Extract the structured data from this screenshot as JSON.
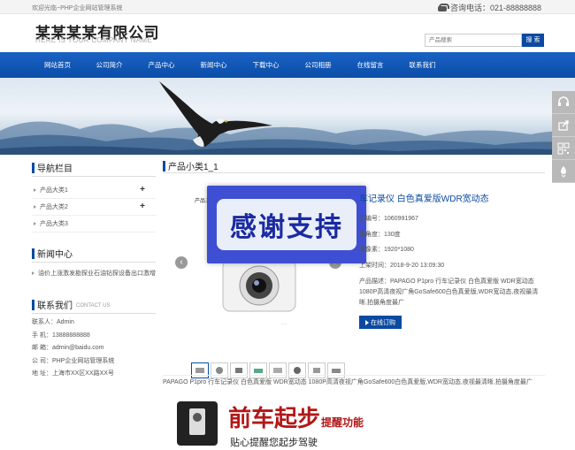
{
  "topbar": {
    "welcome": "欢迎光临~PHP企业网站管理系统",
    "hotline": "咨询电话：021-88888888"
  },
  "header": {
    "company_name": "某某某某有限公司",
    "company_en": "HERE IS YOUR COMPANY NAME",
    "search_placeholder": "产品搜索",
    "search_button": "搜 索"
  },
  "nav": {
    "items": [
      "网站首页",
      "公司简介",
      "产品中心",
      "新闻中心",
      "下载中心",
      "公司相册",
      "在线留言",
      "联系我们"
    ]
  },
  "sidebar": {
    "nav_title": "导航栏目",
    "categories": [
      {
        "label": "产品大类1",
        "has_children": true
      },
      {
        "label": "产品大类2",
        "has_children": true
      },
      {
        "label": "产品大类3",
        "has_children": false
      }
    ],
    "news_title": "新闻中心",
    "news": [
      "油价上涨激发勘探业石油钻探设备出口激增"
    ],
    "contact_title": "联系我们",
    "contact_en": "CONTACT US",
    "contact": [
      "联系人：Admin",
      "手 机：13888888888",
      "邮 箱：admin@baidu.com",
      "公 司：PHP企业网站管理系统",
      "地 址：上海市XX区XX路XX号"
    ]
  },
  "main": {
    "breadcrumb_title": "产品小类1_1",
    "overlay_text": "感谢支持",
    "product": {
      "title": "车记录仪 白色真爱版WDR宽动态",
      "code": "品编号：1060991967",
      "angle": "摄角度：130度",
      "pixels": "摄像素：1920*1080",
      "date": "上架时间：2018-9-20 13:09:30",
      "desc": "产品描述：PAPAGO P1pro 行车记录仪 白色真爱版 WDR宽动态 1080P高清夜视广角GoSafe600白色真爱版,WDR宽动态,夜视最清晰,拍摄角度最广",
      "order_button": "在线订购"
    },
    "full_description": "PAPAGO P1pro 行车记录仪 白色真爱版 WDR宽动态 1080P高清夜视广角GoSafe600白色真爱版,WDR宽动态,夜视最清晰,拍摄角度最广",
    "gallery_tag": "产品五面展示",
    "promo": {
      "headline": "前车起步",
      "tag": "提醒功能",
      "sub": "贴心提醒您起步驾驶"
    }
  }
}
